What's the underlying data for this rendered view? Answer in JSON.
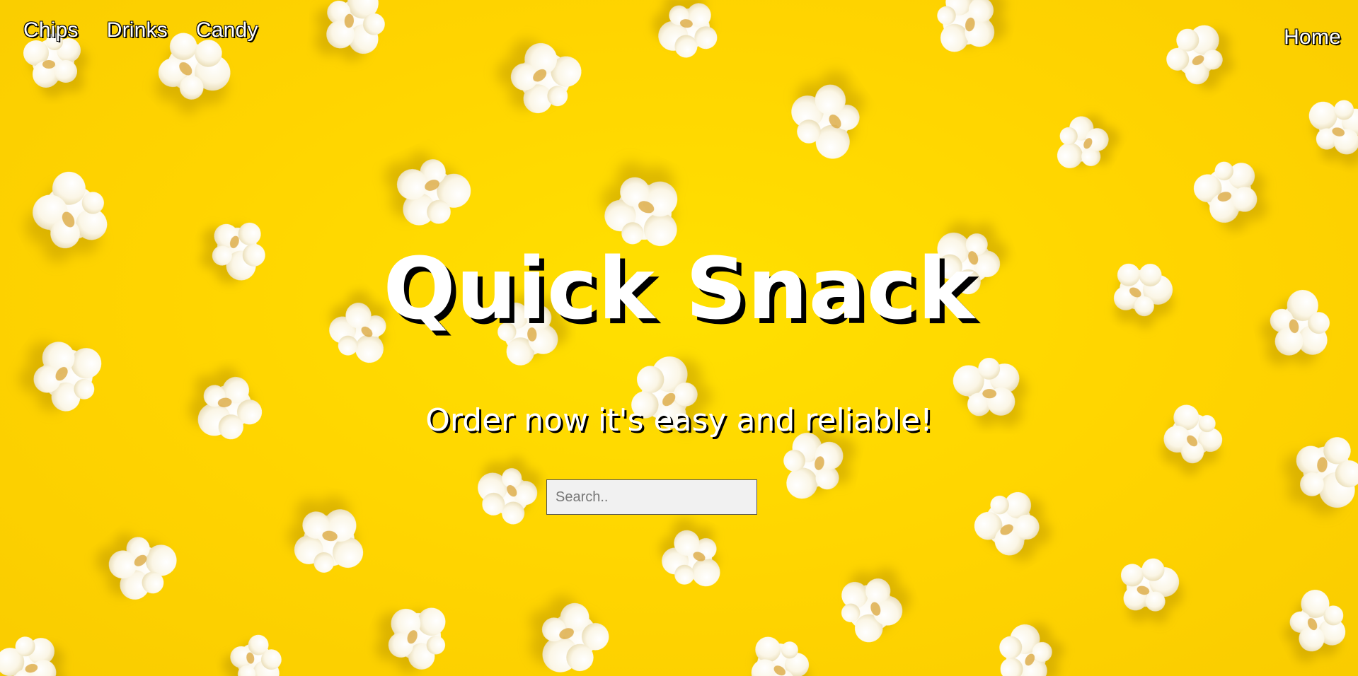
{
  "nav": {
    "left_links": [
      {
        "label": "Chips"
      },
      {
        "label": "Drinks"
      },
      {
        "label": "Candy"
      }
    ],
    "right_link": {
      "label": "Home"
    }
  },
  "hero": {
    "title": "Quick Snack",
    "tagline": "Order now it's easy and reliable!",
    "background_color": "#ffd900",
    "background_subject": "popcorn-pattern"
  },
  "search": {
    "placeholder": "Search..",
    "value": ""
  }
}
